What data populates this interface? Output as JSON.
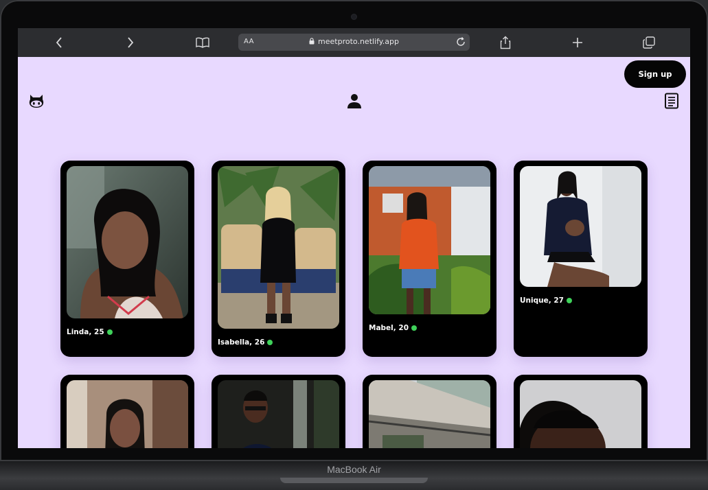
{
  "browser": {
    "text_size_label": "AA",
    "url": "meetproto.netlify.app"
  },
  "device": {
    "brand": "MacBook Air"
  },
  "header": {
    "signup_label": "Sign up"
  },
  "colors": {
    "page_bg": "#e8d9ff",
    "card_bg": "#000000",
    "online": "#3fd15a"
  },
  "profiles": [
    {
      "name": "Linda, 25",
      "online": true
    },
    {
      "name": "Isabella, 26",
      "online": true
    },
    {
      "name": "Mabel, 20",
      "online": true
    },
    {
      "name": "Unique, 27",
      "online": true
    },
    {
      "name": "",
      "online": false
    },
    {
      "name": "",
      "online": false
    },
    {
      "name": "",
      "online": false
    },
    {
      "name": "",
      "online": false
    }
  ]
}
